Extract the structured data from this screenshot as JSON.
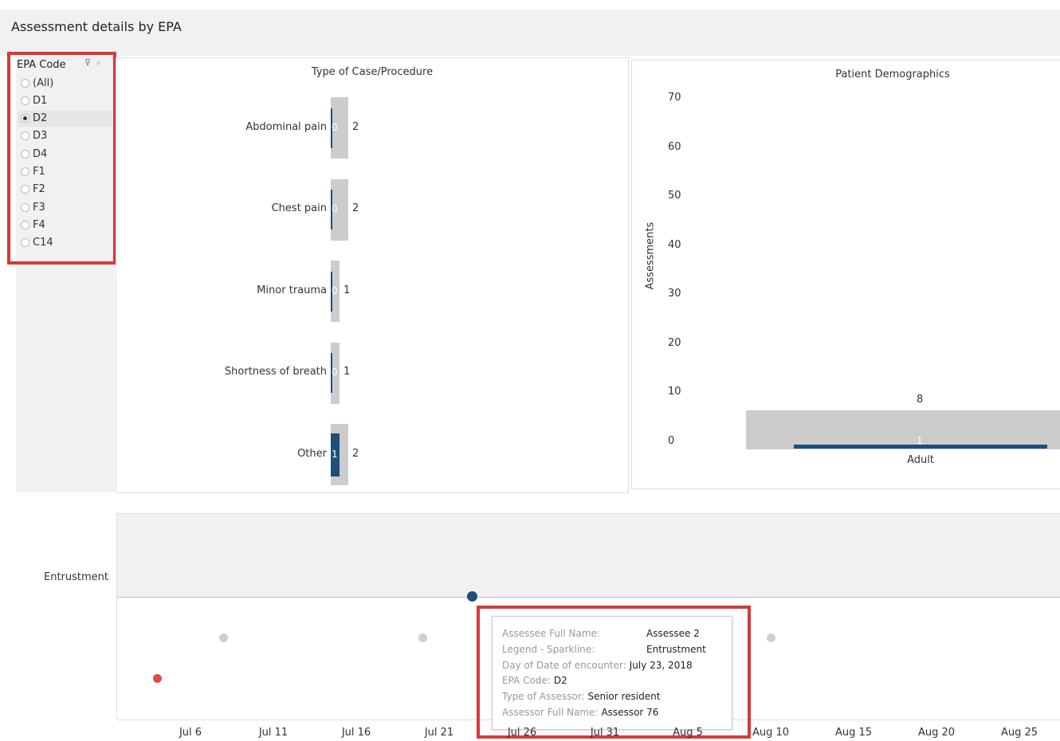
{
  "header": {
    "title": "Assessment details by EPA"
  },
  "filter": {
    "title": "EPA Code",
    "icons": [
      "clear-filter-icon",
      "search-icon"
    ],
    "options": [
      "(All)",
      "D1",
      "D2",
      "D3",
      "D4",
      "F1",
      "F2",
      "F3",
      "F4",
      "C14"
    ],
    "selected": "D2"
  },
  "colors": {
    "accent": "#1f4e79",
    "gray_bar": "#cccccc",
    "red_dot": "#e0484a",
    "gray_dot": "#cfcfcf",
    "highlight": "#d9383a"
  },
  "chart_data": [
    {
      "type": "bar",
      "title": "Type of Case/Procedure",
      "orientation": "horizontal",
      "categories": [
        "Abdominal pain",
        "Chest pain",
        "Minor trauma",
        "Shortness of breath",
        "Other"
      ],
      "series": [
        {
          "values": [
            2,
            2,
            1,
            1,
            2
          ]
        },
        {
          "values": [
            0,
            0,
            0,
            0,
            1
          ]
        }
      ]
    },
    {
      "type": "bar",
      "title": "Patient Demographics",
      "ylabel": "Assessments",
      "ylim": [
        0,
        70
      ],
      "yticks": [
        "70",
        "60",
        "50",
        "40",
        "30",
        "20",
        "10",
        "0"
      ],
      "categories": [
        "Adult"
      ],
      "series": [
        {
          "values": [
            8
          ]
        },
        {
          "values": [
            1
          ]
        }
      ]
    },
    {
      "type": "scatter",
      "ylabel": "Entrustment",
      "xticks": [
        "Jul 6",
        "Jul 11",
        "Jul 16",
        "Jul 21",
        "Jul 26",
        "Jul 31",
        "Aug 5",
        "Aug 10",
        "Aug 15",
        "Aug 20",
        "Aug 25"
      ],
      "points": [
        {
          "date": "2018-07-04",
          "level": "low",
          "color": "red"
        },
        {
          "date": "2018-07-08",
          "level": "mid",
          "color": "gray"
        },
        {
          "date": "2018-07-20",
          "level": "mid",
          "color": "gray"
        },
        {
          "date": "2018-07-23",
          "level": "entrustment",
          "color": "blue"
        },
        {
          "date": "2018-08-10",
          "level": "mid",
          "color": "gray"
        }
      ]
    }
  ],
  "tooltip": {
    "rows": [
      {
        "key": "Assessee Full Name:",
        "value": "Assessee 2"
      },
      {
        "key": "Legend - Sparkline:",
        "value": "Entrustment"
      },
      {
        "key": "Day of Date of encounter:",
        "value": "July 23, 2018"
      },
      {
        "key": "EPA Code:",
        "value": "D2"
      },
      {
        "key": "Type of Assessor:",
        "value": "Senior resident"
      },
      {
        "key": "Assessor Full Name:",
        "value": "Assessor 76"
      }
    ]
  }
}
